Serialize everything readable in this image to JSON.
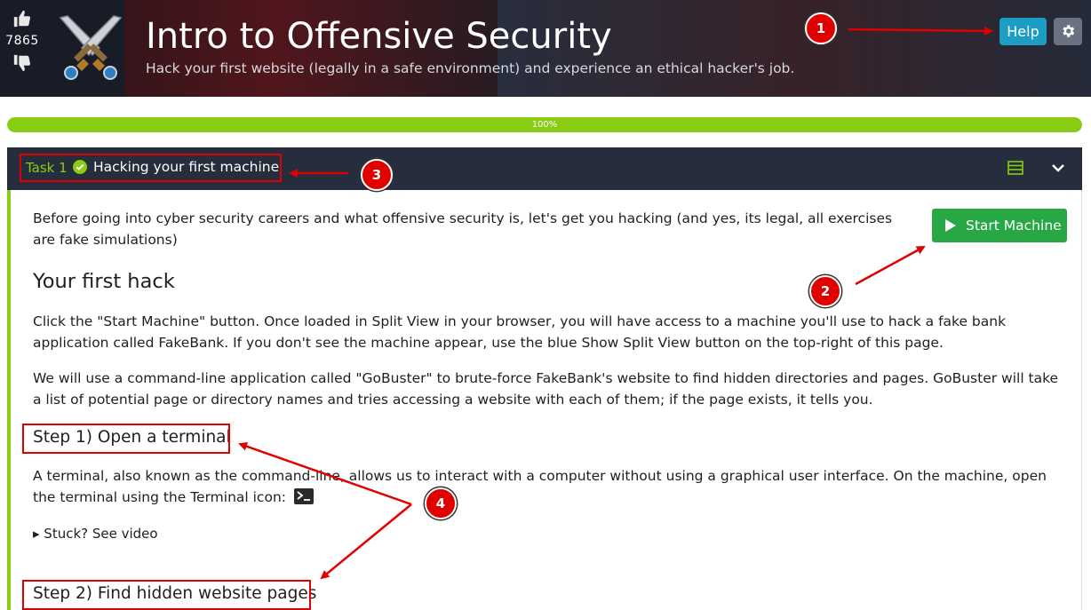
{
  "room": {
    "title": "Intro to Offensive Security",
    "subtitle": "Hack your first website (legally in a safe environment) and experience an ethical hacker's job.",
    "votes": "7865"
  },
  "header_actions": {
    "help_label": "Help"
  },
  "progress": {
    "percent": 100,
    "label": "100%"
  },
  "task": {
    "number_label": "Task 1",
    "title": "Hacking your first machine",
    "completed": true
  },
  "content": {
    "intro": "Before going into cyber security careers and what offensive security is, let's get you hacking (and yes, its legal, all exercises are fake simulations)",
    "start_machine_label": "Start Machine",
    "heading": "Your first hack",
    "para1": "Click the \"Start Machine\" button. Once loaded in Split View in your browser, you will have access to a machine you'll use to hack a fake bank application called FakeBank. If you don't see the machine appear, use the blue Show Split View button on the top-right of this page.",
    "para2": "We will use a command-line application called \"GoBuster\" to brute-force FakeBank's website to find hidden directories and pages. GoBuster will take a list of potential page or directory names and tries accessing a website with each of them; if the page exists, it tells you.",
    "step1_heading": "Step 1) Open a terminal",
    "step1_text": "A terminal, also known as the command-line, allows us to interact with a computer without using a graphical user interface. On the machine, open the terminal using the Terminal icon:",
    "stuck_label": "▸ Stuck? See video",
    "step2_heading": "Step 2) Find hidden website pages"
  },
  "annotations": {
    "badge1": "1",
    "badge2": "2",
    "badge3": "3",
    "badge4": "4"
  },
  "colors": {
    "accent_green": "#88cc14",
    "help_blue": "#1c9ec4",
    "start_green": "#27a844",
    "annotation_red": "#e00000",
    "header_dark": "#262d3c"
  },
  "icons": [
    "thumbs-up-icon",
    "thumbs-down-icon",
    "crossed-swords-logo",
    "gear-icon",
    "check-circle-icon",
    "list-icon",
    "chevron-down-icon",
    "play-icon",
    "terminal-icon"
  ]
}
